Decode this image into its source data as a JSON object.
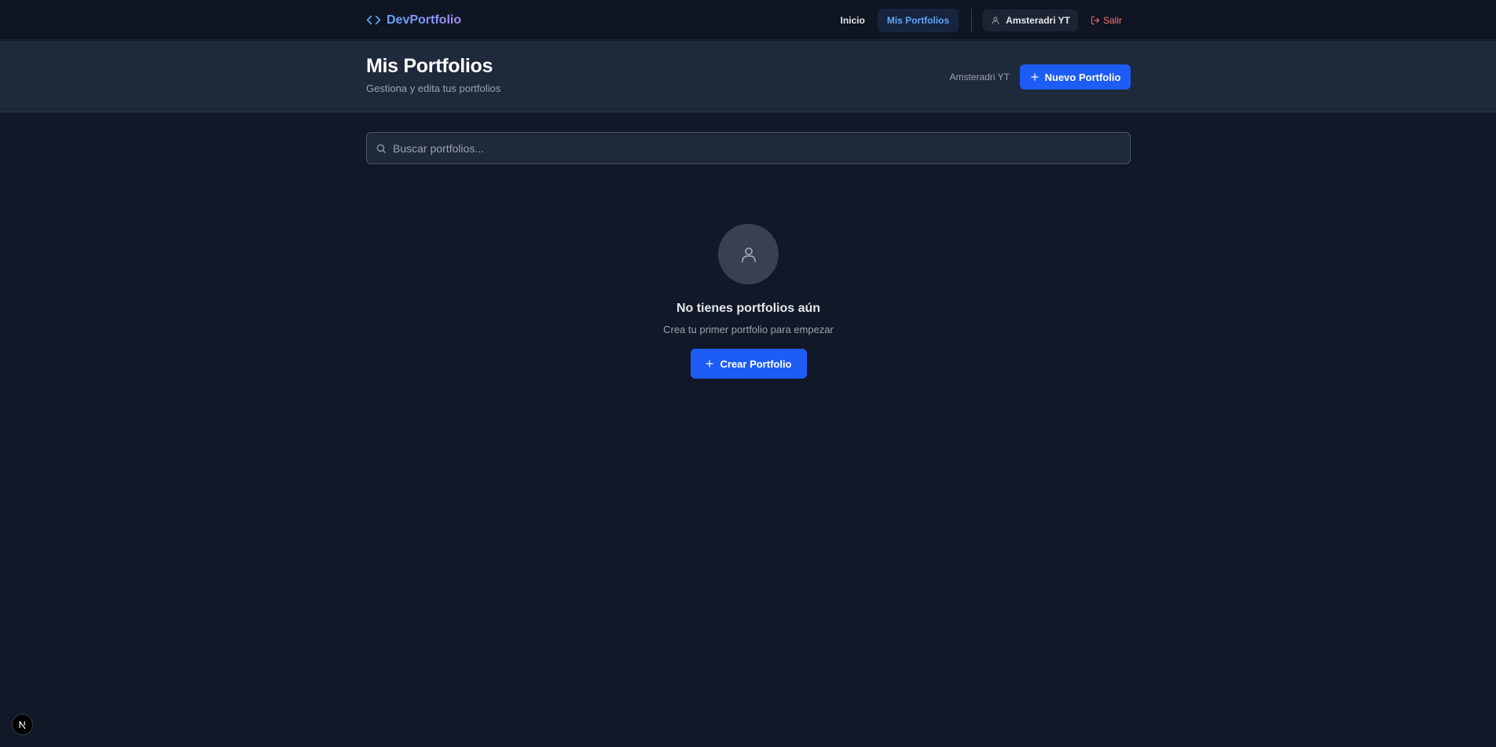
{
  "navbar": {
    "brand": "DevPortfolio",
    "links": [
      {
        "label": "Inicio",
        "active": false
      },
      {
        "label": "Mis Portfolios",
        "active": true
      }
    ],
    "user_name": "Amsteradri YT",
    "logout_label": "Salir"
  },
  "header": {
    "title": "Mis Portfolios",
    "subtitle": "Gestiona y edita tus portfolios",
    "user_name": "Amsteradri YT",
    "new_button_label": "Nuevo Portfolio"
  },
  "search": {
    "placeholder": "Buscar portfolios...",
    "value": ""
  },
  "empty_state": {
    "title": "No tienes portfolios aún",
    "text": "Crea tu primer portfolio para empezar",
    "button_label": "Crear Portfolio"
  },
  "colors": {
    "background": "#111827",
    "header_background": "#1e293b",
    "primary": "#1d5cf5",
    "active_link": "#60a5fa",
    "logout": "#f87171"
  },
  "icons": {
    "brand": "code-icon",
    "user": "user-icon",
    "logout": "logout-icon",
    "plus": "plus-icon",
    "search": "search-icon",
    "badge": "nextjs-icon"
  }
}
